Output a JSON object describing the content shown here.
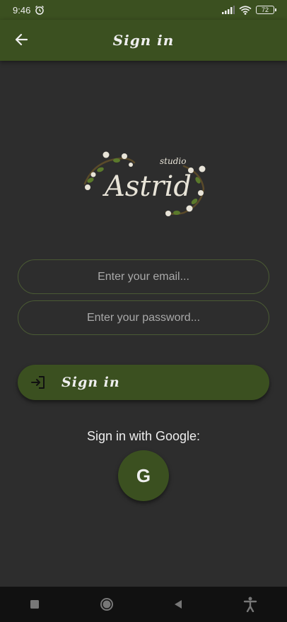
{
  "status": {
    "time": "9:46",
    "battery": "72"
  },
  "app_bar": {
    "title": "Sign in"
  },
  "logo": {
    "small": "studio",
    "main": "Astrid"
  },
  "form": {
    "email_placeholder": "Enter your email...",
    "password_placeholder": "Enter your password..."
  },
  "signin_button": {
    "label": "Sign in"
  },
  "google": {
    "label": "Sign in with Google:",
    "button": "G"
  },
  "icons": {
    "back": "arrow-left-icon",
    "signin": "login-icon",
    "alarm": "alarm-icon",
    "signal": "signal-icon",
    "wifi": "wifi-icon",
    "battery": "battery-icon",
    "nav_recents": "square-icon",
    "nav_home": "circle-icon",
    "nav_back": "triangle-icon",
    "nav_accessibility": "accessibility-icon"
  },
  "colors": {
    "background": "#2d2d2d",
    "primary": "#3b5020",
    "text": "#eeeeee"
  }
}
